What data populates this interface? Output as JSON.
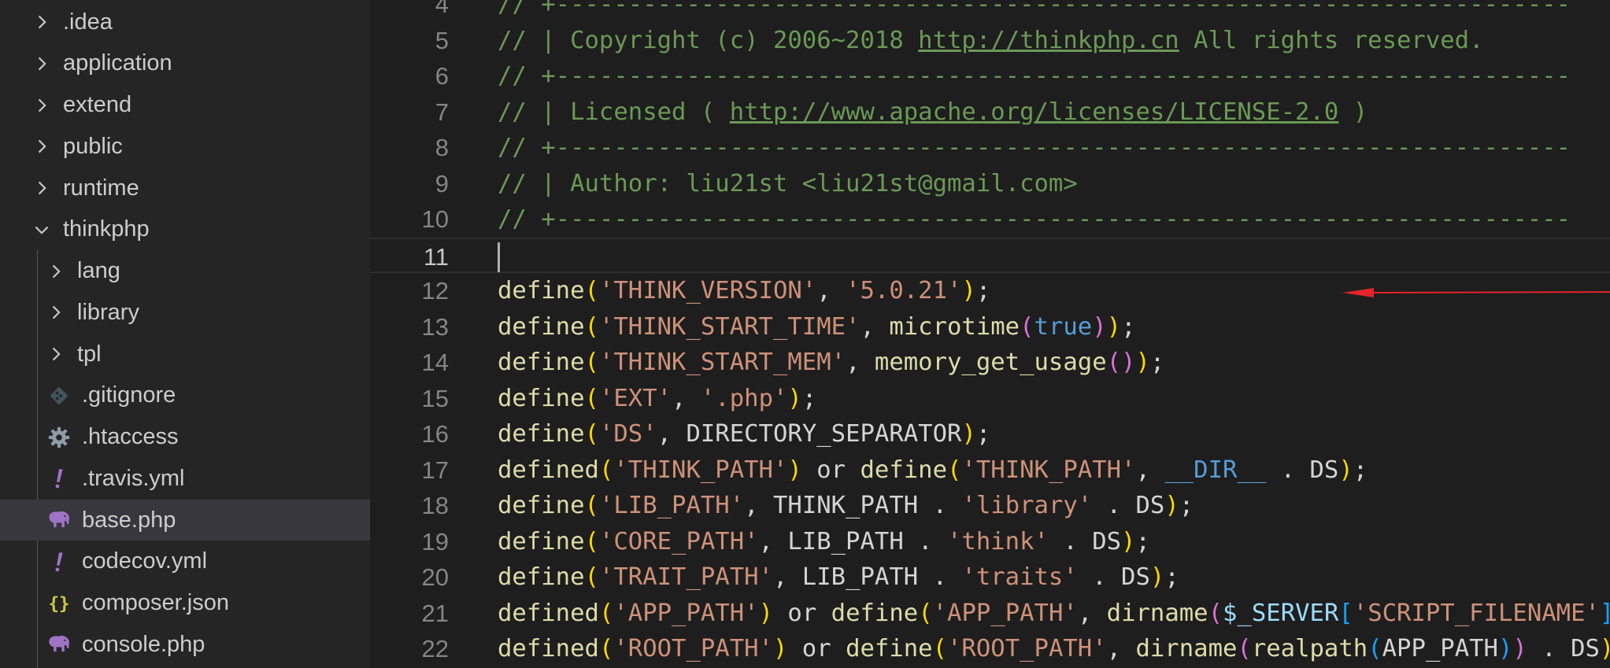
{
  "explorer": {
    "items": [
      {
        "label": ".idea",
        "kind": "folder",
        "expanded": false,
        "depth": 0
      },
      {
        "label": "application",
        "kind": "folder",
        "expanded": false,
        "depth": 0
      },
      {
        "label": "extend",
        "kind": "folder",
        "expanded": false,
        "depth": 0
      },
      {
        "label": "public",
        "kind": "folder",
        "expanded": false,
        "depth": 0
      },
      {
        "label": "runtime",
        "kind": "folder",
        "expanded": false,
        "depth": 0
      },
      {
        "label": "thinkphp",
        "kind": "folder",
        "expanded": true,
        "depth": 0
      },
      {
        "label": "lang",
        "kind": "folder",
        "expanded": false,
        "depth": 1
      },
      {
        "label": "library",
        "kind": "folder",
        "expanded": false,
        "depth": 1
      },
      {
        "label": "tpl",
        "kind": "folder",
        "expanded": false,
        "depth": 1
      },
      {
        "label": ".gitignore",
        "kind": "file",
        "icon": "git-icon",
        "depth": 1
      },
      {
        "label": ".htaccess",
        "kind": "file",
        "icon": "gear-icon",
        "depth": 1
      },
      {
        "label": ".travis.yml",
        "kind": "file",
        "icon": "yaml-exclamation-icon",
        "depth": 1
      },
      {
        "label": "base.php",
        "kind": "file",
        "icon": "php-elephant-icon",
        "depth": 1,
        "selected": true
      },
      {
        "label": "codecov.yml",
        "kind": "file",
        "icon": "yaml-exclamation-icon",
        "depth": 1
      },
      {
        "label": "composer.json",
        "kind": "file",
        "icon": "json-braces-icon",
        "depth": 1
      },
      {
        "label": "console.php",
        "kind": "file",
        "icon": "php-elephant-icon",
        "depth": 1
      }
    ]
  },
  "colors": {
    "comment": "#6a9955",
    "function": "#dcdcaa",
    "string": "#ce9178",
    "constant": "#569cd6",
    "variable": "#9cdcfe",
    "bracket_1": "#ffd700",
    "bracket_2": "#da70d6",
    "bracket_3": "#179fff",
    "annotation_arrow": "#e5232b"
  },
  "editor": {
    "current_line": 11,
    "lines": [
      {
        "n": "4",
        "tokens": [
          [
            "// +----------------------------------------------------------------------",
            "comment"
          ]
        ]
      },
      {
        "n": "5",
        "tokens": [
          [
            "// | Copyright (c) 2006~2018 ",
            "comment"
          ],
          [
            "http://thinkphp.cn",
            "link"
          ],
          [
            " All rights reserved.",
            "comment"
          ]
        ]
      },
      {
        "n": "6",
        "tokens": [
          [
            "// +----------------------------------------------------------------------",
            "comment"
          ]
        ]
      },
      {
        "n": "7",
        "tokens": [
          [
            "// | Licensed ( ",
            "comment"
          ],
          [
            "http://www.apache.org/licenses/LICENSE-2.0",
            "link"
          ],
          [
            " )",
            "comment"
          ]
        ]
      },
      {
        "n": "8",
        "tokens": [
          [
            "// +----------------------------------------------------------------------",
            "comment"
          ]
        ]
      },
      {
        "n": "9",
        "tokens": [
          [
            "// | Author: liu21st <liu21st@gmail.com>",
            "comment"
          ]
        ]
      },
      {
        "n": "10",
        "tokens": [
          [
            "// +----------------------------------------------------------------------",
            "comment"
          ]
        ]
      },
      {
        "n": "11",
        "tokens": []
      },
      {
        "n": "12",
        "tokens": [
          [
            "define",
            "func"
          ],
          [
            "(",
            "p1"
          ],
          [
            "'THINK_VERSION'",
            "str"
          ],
          [
            ", ",
            "plain"
          ],
          [
            "'5.0.21'",
            "str"
          ],
          [
            ")",
            "p1"
          ],
          [
            ";",
            "plain"
          ]
        ]
      },
      {
        "n": "13",
        "tokens": [
          [
            "define",
            "func"
          ],
          [
            "(",
            "p1"
          ],
          [
            "'THINK_START_TIME'",
            "str"
          ],
          [
            ", ",
            "plain"
          ],
          [
            "microtime",
            "func"
          ],
          [
            "(",
            "p2"
          ],
          [
            "true",
            "const"
          ],
          [
            ")",
            "p2"
          ],
          [
            ")",
            "p1"
          ],
          [
            ";",
            "plain"
          ]
        ]
      },
      {
        "n": "14",
        "tokens": [
          [
            "define",
            "func"
          ],
          [
            "(",
            "p1"
          ],
          [
            "'THINK_START_MEM'",
            "str"
          ],
          [
            ", ",
            "plain"
          ],
          [
            "memory_get_usage",
            "func"
          ],
          [
            "()",
            "p2"
          ],
          [
            ")",
            "p1"
          ],
          [
            ";",
            "plain"
          ]
        ]
      },
      {
        "n": "15",
        "tokens": [
          [
            "define",
            "func"
          ],
          [
            "(",
            "p1"
          ],
          [
            "'EXT'",
            "str"
          ],
          [
            ", ",
            "plain"
          ],
          [
            "'.php'",
            "str"
          ],
          [
            ")",
            "p1"
          ],
          [
            ";",
            "plain"
          ]
        ]
      },
      {
        "n": "16",
        "tokens": [
          [
            "define",
            "func"
          ],
          [
            "(",
            "p1"
          ],
          [
            "'DS'",
            "str"
          ],
          [
            ", DIRECTORY_SEPARATOR",
            "plain"
          ],
          [
            ")",
            "p1"
          ],
          [
            ";",
            "plain"
          ]
        ]
      },
      {
        "n": "17",
        "tokens": [
          [
            "defined",
            "func"
          ],
          [
            "(",
            "p1"
          ],
          [
            "'THINK_PATH'",
            "str"
          ],
          [
            ")",
            "p1"
          ],
          [
            " or ",
            "plain"
          ],
          [
            "define",
            "func"
          ],
          [
            "(",
            "p1"
          ],
          [
            "'THINK_PATH'",
            "str"
          ],
          [
            ", ",
            "plain"
          ],
          [
            "__DIR__",
            "const"
          ],
          [
            " . DS",
            "plain"
          ],
          [
            ")",
            "p1"
          ],
          [
            ";",
            "plain"
          ]
        ]
      },
      {
        "n": "18",
        "tokens": [
          [
            "define",
            "func"
          ],
          [
            "(",
            "p1"
          ],
          [
            "'LIB_PATH'",
            "str"
          ],
          [
            ", THINK_PATH . ",
            "plain"
          ],
          [
            "'library'",
            "str"
          ],
          [
            " . DS",
            "plain"
          ],
          [
            ")",
            "p1"
          ],
          [
            ";",
            "plain"
          ]
        ]
      },
      {
        "n": "19",
        "tokens": [
          [
            "define",
            "func"
          ],
          [
            "(",
            "p1"
          ],
          [
            "'CORE_PATH'",
            "str"
          ],
          [
            ", LIB_PATH . ",
            "plain"
          ],
          [
            "'think'",
            "str"
          ],
          [
            " . DS",
            "plain"
          ],
          [
            ")",
            "p1"
          ],
          [
            ";",
            "plain"
          ]
        ]
      },
      {
        "n": "20",
        "tokens": [
          [
            "define",
            "func"
          ],
          [
            "(",
            "p1"
          ],
          [
            "'TRAIT_PATH'",
            "str"
          ],
          [
            ", LIB_PATH . ",
            "plain"
          ],
          [
            "'traits'",
            "str"
          ],
          [
            " . DS",
            "plain"
          ],
          [
            ")",
            "p1"
          ],
          [
            ";",
            "plain"
          ]
        ]
      },
      {
        "n": "21",
        "tokens": [
          [
            "defined",
            "func"
          ],
          [
            "(",
            "p1"
          ],
          [
            "'APP_PATH'",
            "str"
          ],
          [
            ")",
            "p1"
          ],
          [
            " or ",
            "plain"
          ],
          [
            "define",
            "func"
          ],
          [
            "(",
            "p1"
          ],
          [
            "'APP_PATH'",
            "str"
          ],
          [
            ", ",
            "plain"
          ],
          [
            "dirname",
            "func"
          ],
          [
            "(",
            "p2"
          ],
          [
            "$_SERVER",
            "var"
          ],
          [
            "[",
            "p3"
          ],
          [
            "'SCRIPT_FILENAME'",
            "str"
          ],
          [
            "]",
            "p3"
          ]
        ]
      },
      {
        "n": "22",
        "tokens": [
          [
            "defined",
            "func"
          ],
          [
            "(",
            "p1"
          ],
          [
            "'ROOT_PATH'",
            "str"
          ],
          [
            ")",
            "p1"
          ],
          [
            " or ",
            "plain"
          ],
          [
            "define",
            "func"
          ],
          [
            "(",
            "p1"
          ],
          [
            "'ROOT_PATH'",
            "str"
          ],
          [
            ", ",
            "plain"
          ],
          [
            "dirname",
            "func"
          ],
          [
            "(",
            "p2"
          ],
          [
            "realpath",
            "func"
          ],
          [
            "(",
            "p3"
          ],
          [
            "APP_PATH",
            "plain"
          ],
          [
            ")",
            "p3"
          ],
          [
            ")",
            "p2"
          ],
          [
            " . DS",
            "plain"
          ],
          [
            ")",
            "p1"
          ]
        ]
      }
    ]
  }
}
